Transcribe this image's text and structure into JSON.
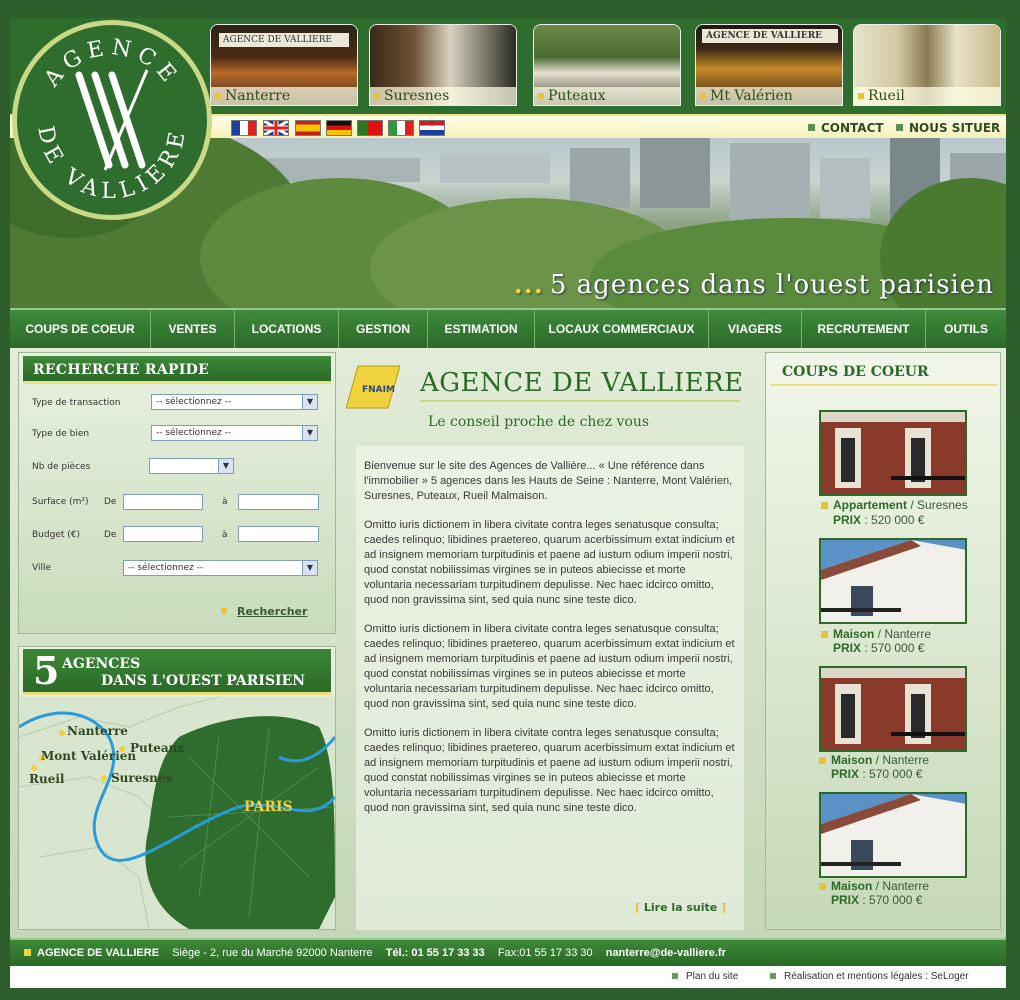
{
  "agencies": [
    {
      "name": "Nanterre"
    },
    {
      "name": "Suresnes"
    },
    {
      "name": "Puteaux"
    },
    {
      "name": "Mt Valérien"
    },
    {
      "name": "Rueil"
    }
  ],
  "logo": {
    "top_text": "AGENCE",
    "bottom_text": "DE VALLIERE"
  },
  "thumb_sign": "AGENCE DE VALLIERE",
  "flags": [
    "fr",
    "en",
    "es",
    "de",
    "pt",
    "it",
    "nl"
  ],
  "top_links": {
    "contact": "CONTACT",
    "locate": "NOUS SITUER"
  },
  "banner": {
    "dots": "...",
    "tagline": "5 agences dans l'ouest parisien"
  },
  "nav": [
    "COUPS DE COEUR",
    "VENTES",
    "LOCATIONS",
    "GESTION",
    "ESTIMATION",
    "LOCAUX COMMERCIAUX",
    "VIAGERS",
    "RECRUTEMENT",
    "OUTILS"
  ],
  "search": {
    "title": "RECHERCHE RAPIDE",
    "transaction_label": "Type de transaction",
    "transaction_value": "-- sélectionnez --",
    "property_label": "Type de bien",
    "property_value": "-- sélectionnez --",
    "rooms_label": "Nb de pièces",
    "surface_label": "Surface (m²)",
    "budget_label": "Budget (€)",
    "from_label": "De",
    "to_label": "à",
    "city_label": "Ville",
    "city_value": "-- sélectionnez --",
    "search_button": "Rechercher"
  },
  "map": {
    "big_number": "5",
    "title_line1": "AGENCES",
    "title_line2": "DANS L'OUEST PARISIEN",
    "places": [
      "Nanterre",
      "Mont Valérien",
      "Puteaux",
      "Rueil",
      "Suresnes",
      "PARIS"
    ]
  },
  "center": {
    "badge": "FNAIM",
    "title": "AGENCE DE VALLIERE",
    "subtitle": "Le conseil proche de chez vous",
    "intro": "Bienvenue sur le site des Agences de Vallière... « Une référence dans l'immobilier » 5 agences dans les Hauts de Seine : Nanterre, Mont Valérien, Suresnes, Puteaux, Rueil Malmaison.",
    "para": "Omitto iuris dictionem in libera civitate contra leges senatusque consulta; caedes relinquo; libidines praetereo, quarum acerbissimum extat indicium et ad insignem memoriam turpitudinis et paene ad iustum odium imperii nostri, quod constat nobilissimas virgines se in puteos abiecisse et morte voluntaria necessariam turpitudinem depulisse. Nec haec idcirco omitto, quod non gravissima sint, sed quia nunc sine teste dico.",
    "read_more": "Lire la suite"
  },
  "favorites": {
    "title": "COUPS DE COEUR",
    "price_label": "PRIX",
    "items": [
      {
        "type": "Appartement",
        "city": "Suresnes",
        "price": "520 000 €"
      },
      {
        "type": "Maison",
        "city": "Nanterre",
        "price": "570 000 €"
      },
      {
        "type": "Maison",
        "city": "Nanterre",
        "price": "570 000 €"
      },
      {
        "type": "Maison",
        "city": "Nanterre",
        "price": "570 000 €"
      }
    ]
  },
  "footer": {
    "name": "AGENCE DE VALLIERE",
    "address": "Siège - 2, rue du Marché 92000 Nanterre",
    "phone": "Tél.: 01 55 17 33 33",
    "fax": "Fax:01 55 17 33 30",
    "email": "nanterre@de-valliere.fr",
    "sitemap": "Plan du site",
    "credits": "Réalisation et mentions légales : SeLoger"
  },
  "colors": {
    "primary_green": "#2b6a27",
    "accent_yellow": "#e6c43a",
    "page_bg": "#2e5e2c"
  }
}
